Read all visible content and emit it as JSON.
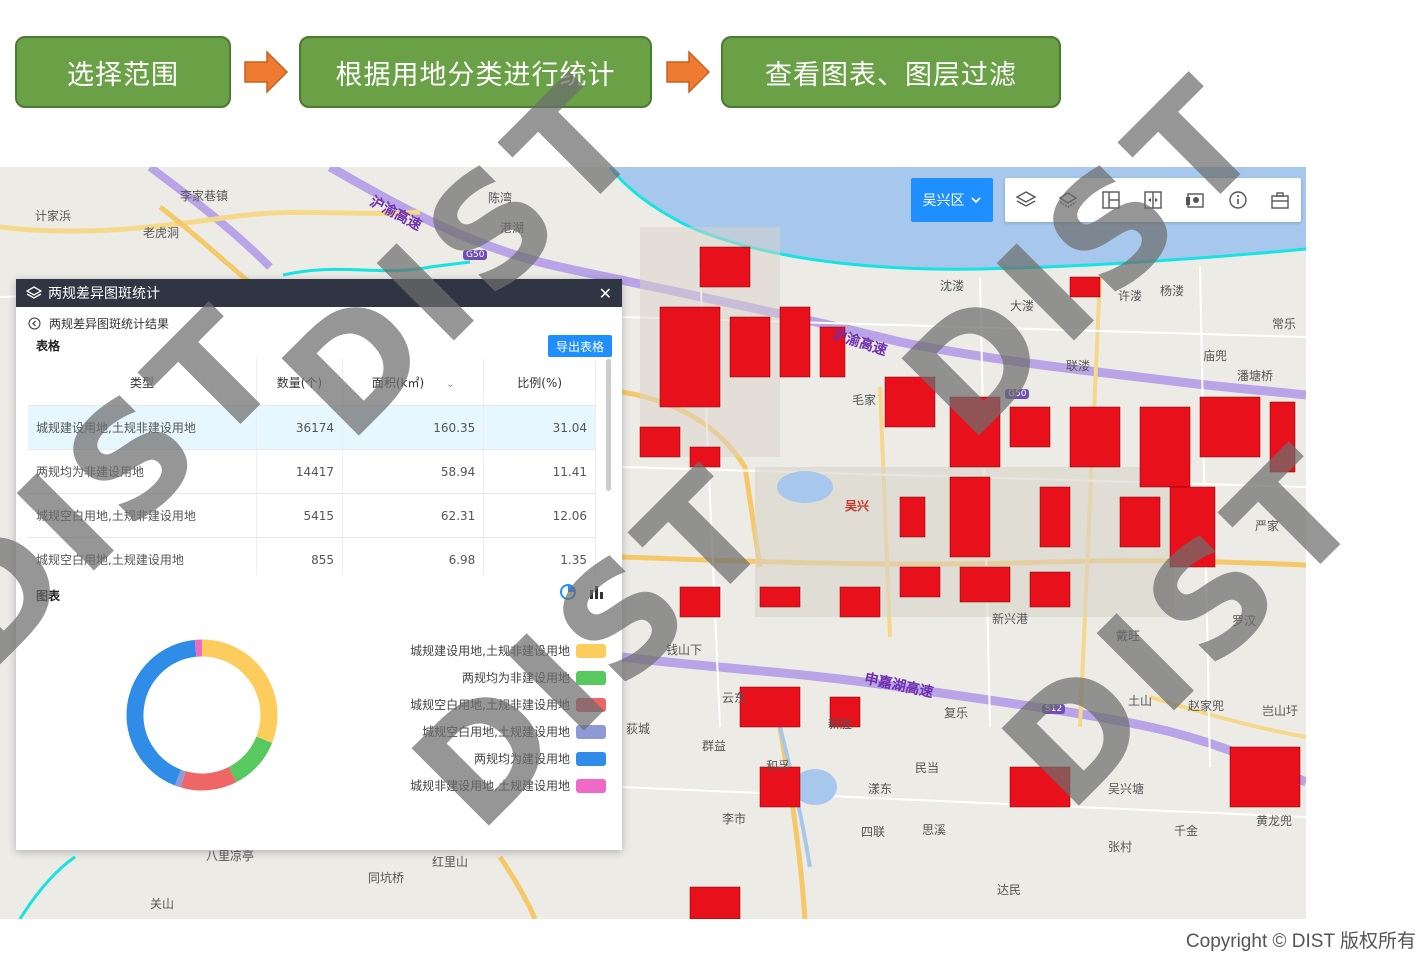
{
  "steps": [
    {
      "label": "选择范围"
    },
    {
      "label": "根据用地分类进行统计"
    },
    {
      "label": "查看图表、图层过滤"
    }
  ],
  "map": {
    "district_selector": "吴兴区",
    "toolbar_icons": [
      "layers-icon",
      "layers-outline-icon",
      "layout-icon",
      "compare-icon",
      "screen-icon",
      "info-icon",
      "toolbox-icon"
    ],
    "places": [
      "李家巷镇",
      "计家浜",
      "老虎洞",
      "陈湾",
      "港湖",
      "沈溇",
      "大溇",
      "许溇",
      "杨溇",
      "常乐",
      "庙兜",
      "潘塘桥",
      "联溇",
      "毛家",
      "吴兴",
      "新兴港",
      "钱山下",
      "罗汉",
      "戴旺",
      "云东",
      "新胜",
      "复乐",
      "土山",
      "赵家兜",
      "岂山圩",
      "群益",
      "和孚",
      "民当",
      "荻城",
      "漾东",
      "吴兴塘",
      "李市",
      "四联",
      "思溪",
      "千金",
      "黄龙兜",
      "张村",
      "达民",
      "同坑桥",
      "红里山",
      "关山",
      "八里凉亭",
      "严家"
    ],
    "highways": [
      "沪渝高速",
      "沪渝高速",
      "申嘉湖高速"
    ],
    "shields": [
      "G50",
      "G50",
      "S12"
    ],
    "colors": {
      "water": "#a7c8ec",
      "parcel": "#e8101a",
      "boundary": "#18e3e3",
      "expressway": "#a98be0"
    }
  },
  "panel": {
    "title": "两规差异图斑统计",
    "subtitle": "两规差异图斑统计结果",
    "table_label": "表格",
    "export_label": "导出表格",
    "columns": [
      "类型",
      "数量(个)",
      "面积(k㎡)",
      "比例(%)"
    ],
    "rows": [
      {
        "type": "城规建设用地,土规非建设用地",
        "count": "36174",
        "area": "160.35",
        "ratio": "31.04"
      },
      {
        "type": "两规均为非建设用地",
        "count": "14417",
        "area": "58.94",
        "ratio": "11.41"
      },
      {
        "type": "城规空白用地,土规非建设用地",
        "count": "5415",
        "area": "62.31",
        "ratio": "12.06"
      },
      {
        "type": "城规空白用地,土规建设用地",
        "count": "855",
        "area": "6.98",
        "ratio": "1.35"
      }
    ],
    "chart_label": "图表",
    "chart_icons": [
      "pie-chart-icon",
      "bar-chart-icon"
    ]
  },
  "chart_data": {
    "type": "pie",
    "donut": true,
    "title": "",
    "categories": [
      "城规建设用地,土规非建设用地",
      "两规均为非建设用地",
      "城规空白用地,土规非建设用地",
      "城规空白用地,土规建设用地",
      "两规均为建设用地",
      "城规非建设用地,土规建设用地"
    ],
    "values": [
      31.04,
      11.41,
      12.06,
      1.35,
      42.6,
      1.54
    ],
    "colors": [
      "#fccd5c",
      "#58c95e",
      "#ee6666",
      "#8d9ad6",
      "#2f8de8",
      "#ee6ac6"
    ],
    "legend": "right"
  },
  "footer": {
    "copyright": "Copyright ©  DIST 版权所有"
  },
  "watermark": {
    "text": "DIST"
  }
}
